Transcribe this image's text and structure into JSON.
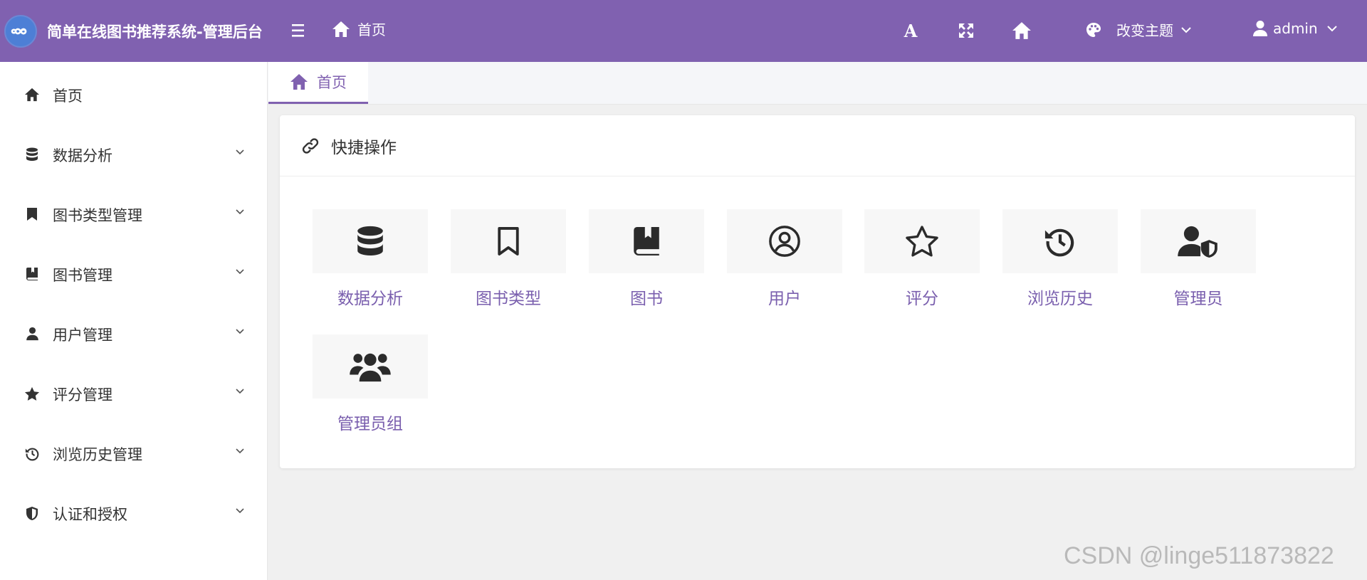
{
  "header": {
    "app_title": "简单在线图书推荐系统-管理后台",
    "breadcrumb_home": "首页",
    "theme_label": "改变主题",
    "user_name": "admin",
    "bg_color": "#8061b0"
  },
  "sidebar": {
    "items": [
      {
        "label": "首页",
        "icon": "home-icon",
        "expandable": false
      },
      {
        "label": "数据分析",
        "icon": "database-icon",
        "expandable": true
      },
      {
        "label": "图书类型管理",
        "icon": "bookmark-icon",
        "expandable": true
      },
      {
        "label": "图书管理",
        "icon": "book-icon",
        "expandable": true
      },
      {
        "label": "用户管理",
        "icon": "user-icon",
        "expandable": true
      },
      {
        "label": "评分管理",
        "icon": "star-icon",
        "expandable": true
      },
      {
        "label": "浏览历史管理",
        "icon": "history-icon",
        "expandable": true
      },
      {
        "label": "认证和授权",
        "icon": "shield-icon",
        "expandable": true
      }
    ]
  },
  "tabs": [
    {
      "label": "首页",
      "active": true
    }
  ],
  "quick": {
    "title": "快捷操作",
    "tiles": [
      {
        "label": "数据分析",
        "icon": "database-icon"
      },
      {
        "label": "图书类型",
        "icon": "bookmark-icon"
      },
      {
        "label": "图书",
        "icon": "book-icon"
      },
      {
        "label": "用户",
        "icon": "user-circle-icon"
      },
      {
        "label": "评分",
        "icon": "star-icon"
      },
      {
        "label": "浏览历史",
        "icon": "history-icon"
      },
      {
        "label": "管理员",
        "icon": "user-shield-icon"
      },
      {
        "label": "管理员组",
        "icon": "users-icon"
      }
    ]
  },
  "watermark": "CSDN @linge511873822"
}
